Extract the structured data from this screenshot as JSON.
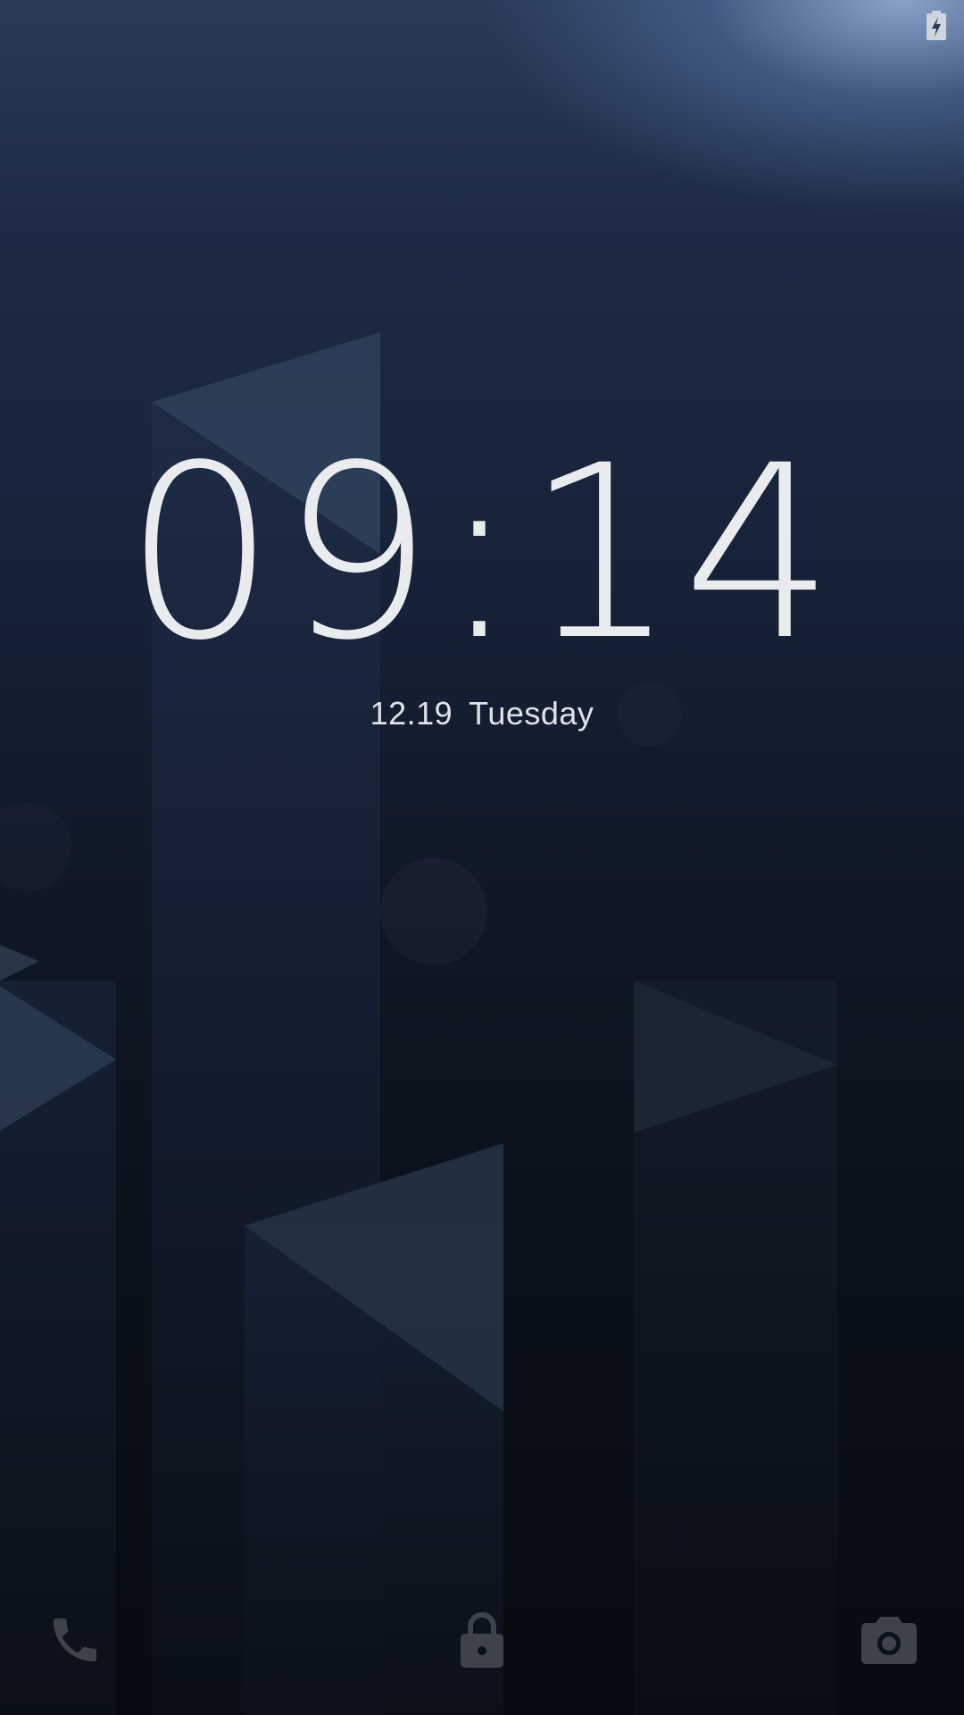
{
  "status_bar": {
    "battery_icon": "battery-charging-icon"
  },
  "lockscreen": {
    "time": "09:14",
    "date": "12.19",
    "weekday": "Tuesday"
  },
  "shortcuts": {
    "left_icon": "phone-icon",
    "center_icon": "lock-icon",
    "right_icon": "camera-icon"
  },
  "colors": {
    "text": "#e9ebee",
    "icon": "#3e434a",
    "background_top": "#2a3a58",
    "background_bottom": "#070a10"
  }
}
